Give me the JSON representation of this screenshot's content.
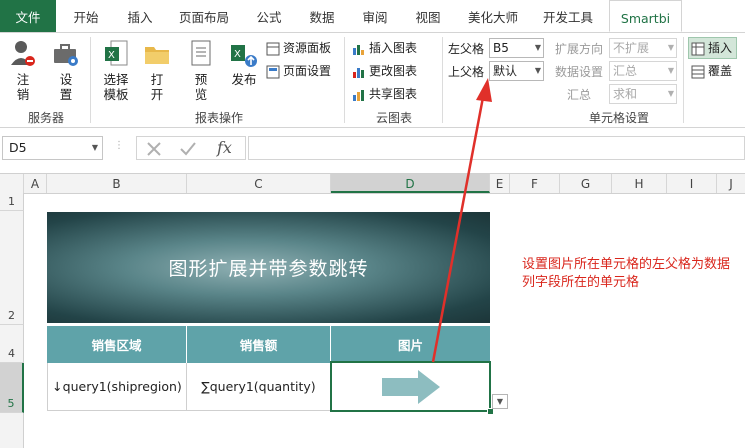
{
  "tabs": [
    "文件",
    "开始",
    "插入",
    "页面布局",
    "公式",
    "数据",
    "审阅",
    "视图",
    "美化大师",
    "开发工具",
    "Smartbi"
  ],
  "ribbon": {
    "server": {
      "logout": "注\n销",
      "settings": "设\n置",
      "group": "服务器"
    },
    "report": {
      "select": "选择\n模板",
      "open": "打\n开",
      "preview": "预\n览",
      "publish": "发布",
      "resource": "资源面板",
      "page_setup": "页面设置",
      "group": "报表操作"
    },
    "cloud": {
      "insert_chart": "插入图表",
      "change_chart": "更改图表",
      "share_chart": "共享图表",
      "group": "云图表"
    },
    "cell": {
      "left_parent_label": "左父格",
      "left_parent_value": "B5",
      "top_parent_label": "上父格",
      "top_parent_value": "默认",
      "expand_dir_label": "扩展方向",
      "expand_dir_value": "不扩展",
      "data_setting_label": "数据设置",
      "data_setting_value": "汇总",
      "summary_label": "汇总",
      "summary_value": "求和",
      "group": "单元格设置"
    },
    "insert": "插入",
    "overwrite": "覆盖"
  },
  "formula_bar": {
    "name_box": "D5",
    "fx": "fx",
    "formula": ""
  },
  "columns": [
    "A",
    "B",
    "C",
    "D",
    "E",
    "F",
    "G",
    "H",
    "I",
    "J"
  ],
  "rows": [
    "1",
    "2",
    "4",
    "5"
  ],
  "sheet": {
    "banner_title": "图形扩展并带参数跳转",
    "headers": [
      "销售区域",
      "销售额",
      "图片"
    ],
    "cells": [
      "↓query1(shipregion)",
      "∑query1(quantity)",
      ""
    ]
  },
  "annotation": "设置图片所在单元格的左父格为数据列字段所在的单元格",
  "colors": {
    "excel_green": "#217346",
    "header_teal": "#5fa3a9",
    "arrow_teal": "#8dbdc0",
    "annotation_red": "#d9261c"
  }
}
